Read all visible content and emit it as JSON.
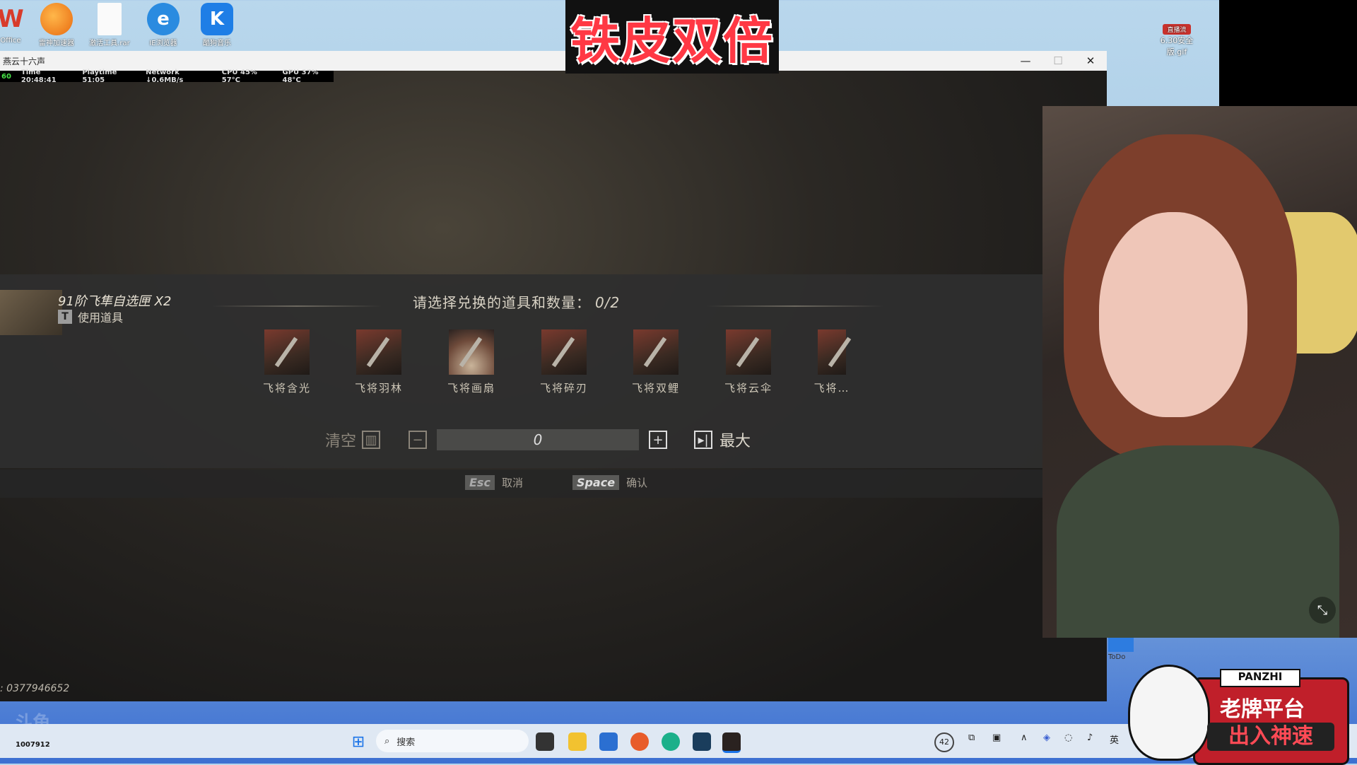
{
  "desktop": {
    "icons": [
      {
        "name": "office",
        "caption": "Office",
        "glyph": "W",
        "color": "#d83b2b"
      },
      {
        "name": "booster",
        "caption": "雷神加速器",
        "glyph": "",
        "color": "#f08a18"
      },
      {
        "name": "file",
        "caption": "激活工具.rar",
        "glyph": "",
        "color": "#f5f5f5"
      },
      {
        "name": "ie",
        "caption": "IE浏览器",
        "glyph": "e",
        "color": "#2a8be0"
      },
      {
        "name": "kugou",
        "caption": "酷狗音乐",
        "glyph": "K",
        "color": "#1e7ee6"
      }
    ],
    "gif_badge": "直播流",
    "gif_caption": "6.30安全版.gif",
    "todo_caption": "ToDo"
  },
  "banner": {
    "text": "铁皮双倍"
  },
  "window": {
    "title": "燕云十六声",
    "minimize": "—",
    "maximize": "☐",
    "close": "✕"
  },
  "overlay_stats": {
    "fps": "60",
    "time": "Time 20:48:41",
    "playtime": "Playtime 51:05",
    "network": "Network ↓0.6MB/s",
    "cpu": "CPU 45%  57°C",
    "gpu": "GPU 37%  48°C"
  },
  "dialog": {
    "item_title": "91阶飞隼自选匣 X2",
    "use_key": "T",
    "use_label": "使用道具",
    "prompt": "请选择兑换的道具和数量：",
    "prompt_count": "0/2",
    "choices": [
      {
        "label": "飞将含光"
      },
      {
        "label": "飞将羽林"
      },
      {
        "label": "飞将画扇"
      },
      {
        "label": "飞将碎刃"
      },
      {
        "label": "飞将双鲤"
      },
      {
        "label": "飞将云伞"
      },
      {
        "label": "飞将…"
      }
    ],
    "clear_label": "清空",
    "quantity": "0",
    "max_label": "最大",
    "esc_key": "Esc",
    "cancel_label": "取消",
    "space_key": "Space",
    "confirm_label": "确认"
  },
  "uid_text": ": 0377946652",
  "taskbar": {
    "left_text": "1007912",
    "search_placeholder": "搜索",
    "weather": "42",
    "lang": "英"
  },
  "ad": {
    "tag": "PANZHI",
    "line1": "老牌平台",
    "line2": "出入神速"
  }
}
